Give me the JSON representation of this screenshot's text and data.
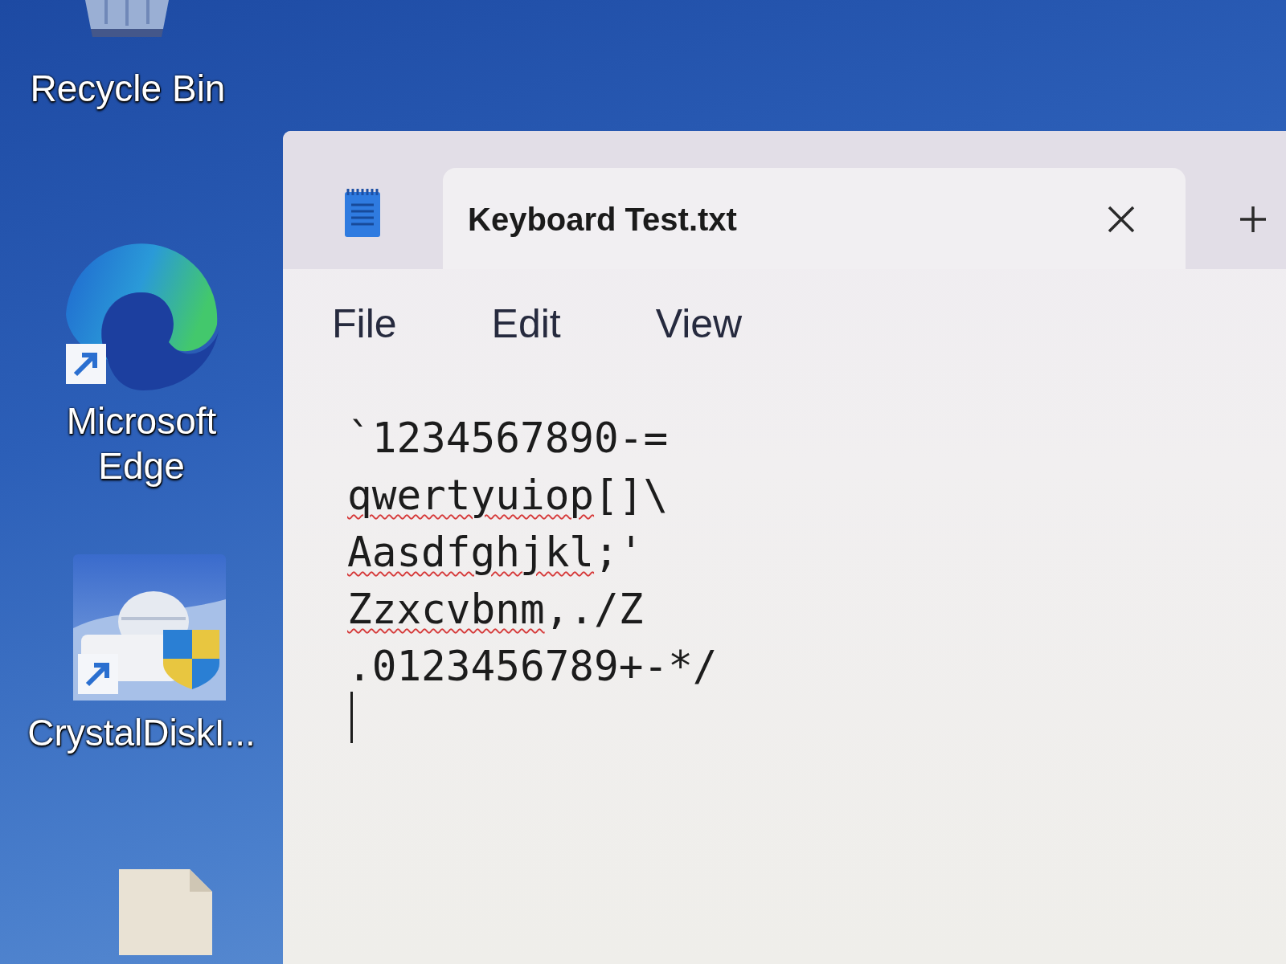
{
  "desktop_icons": [
    {
      "kind": "recycle_bin",
      "label": "Recycle Bin",
      "shortcut": false
    },
    {
      "kind": "browser",
      "label": "Microsoft Edge",
      "shortcut": true
    },
    {
      "kind": "disk_utility",
      "label": "CrystalDiskI...",
      "shortcut": true
    },
    {
      "kind": "document"
    }
  ],
  "window": {
    "tabs": [
      {
        "title": "Keyboard Test.txt",
        "selected": true
      }
    ],
    "menu": [
      "File",
      "Edit",
      "View"
    ],
    "editor": {
      "lines": [
        {
          "segments": [
            {
              "text": "`1234567890-=",
              "misspelled": false
            }
          ]
        },
        {
          "segments": [
            {
              "text": "qwertyuiop",
              "misspelled": true
            },
            {
              "text": "[]\\",
              "misspelled": false
            }
          ]
        },
        {
          "segments": [
            {
              "text": "Aasdfghjkl",
              "misspelled": true
            },
            {
              "text": ";'",
              "misspelled": false
            }
          ]
        },
        {
          "segments": [
            {
              "text": "Zzxcvbnm",
              "misspelled": true
            },
            {
              "text": ",./Z",
              "misspelled": false
            }
          ]
        },
        {
          "segments": [
            {
              "text": ".0123456789+-*/",
              "misspelled": false
            }
          ]
        }
      ]
    }
  }
}
